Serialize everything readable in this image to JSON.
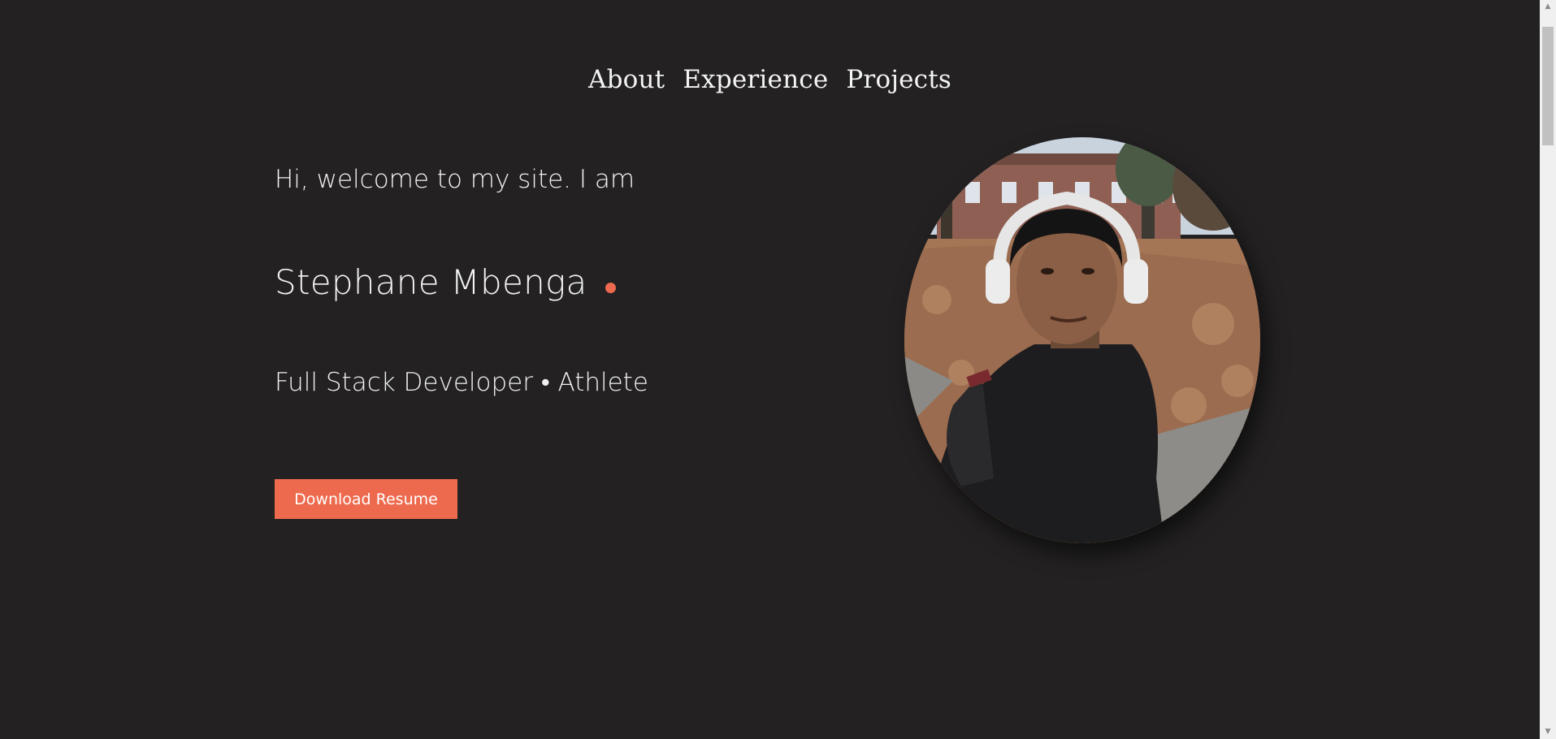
{
  "nav": {
    "items": [
      {
        "label": "About"
      },
      {
        "label": "Experience"
      },
      {
        "label": "Projects"
      }
    ]
  },
  "hero": {
    "greeting": "Hi, welcome to my site. I am",
    "name": "Stephane Mbenga",
    "tagline": "Full Stack Developer • Athlete",
    "resume_button": "Download Resume"
  },
  "colors": {
    "background": "#232122",
    "accent": "#ee6a4e",
    "text": "#f2f2f2"
  },
  "scrollbar": {
    "up_glyph": "▲",
    "down_glyph": "▼"
  }
}
